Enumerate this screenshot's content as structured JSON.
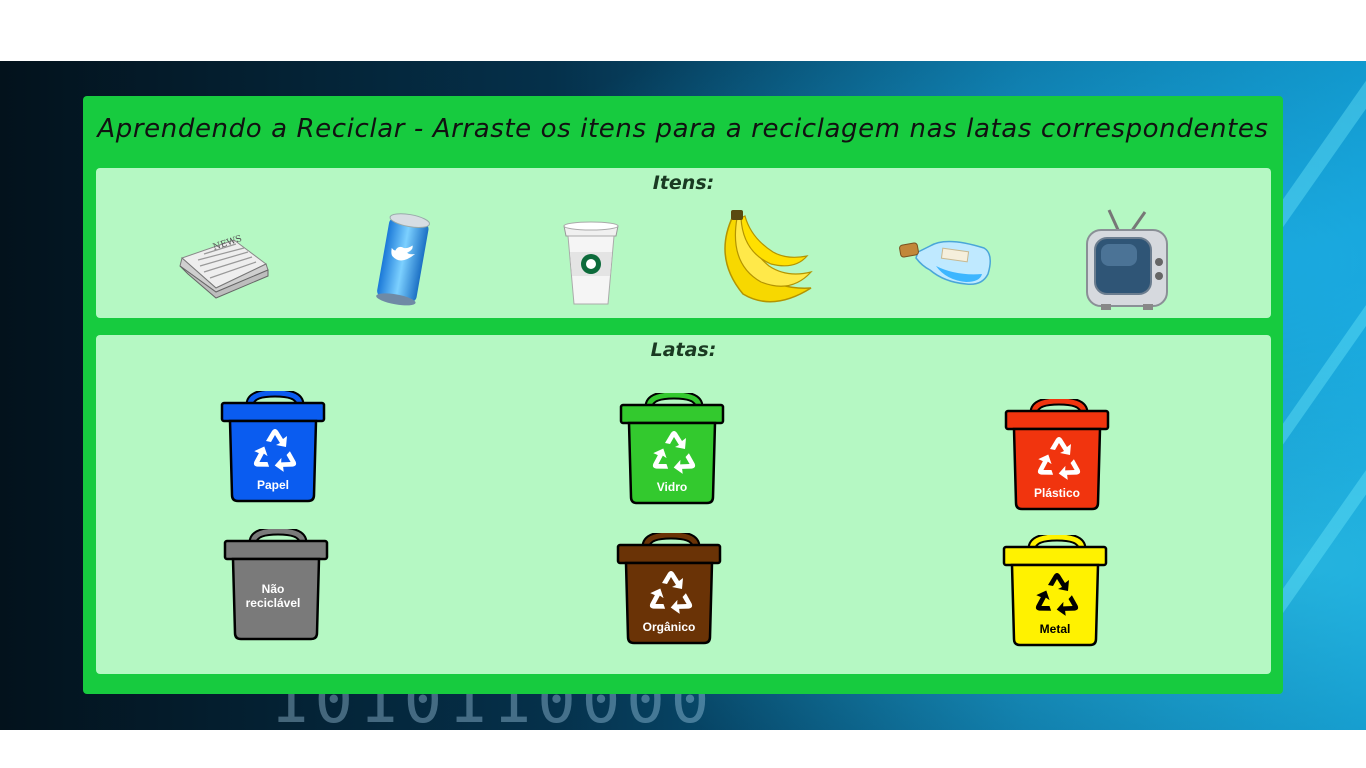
{
  "title": "Aprendendo a Reciclar - Arraste os itens para a reciclagem nas latas correspondentes",
  "items_section": {
    "label": "Itens:",
    "items": [
      "newspaper-icon",
      "soda-can-icon",
      "coffee-cup-icon",
      "banana-icon",
      "glass-bottle-icon",
      "television-icon"
    ]
  },
  "cans_section": {
    "label": "Latas:",
    "cans": [
      {
        "label_line1": "Papel",
        "label_line2": "",
        "color": "#0a5cf0",
        "symbol_color": "#ffffff"
      },
      {
        "label_line1": "Vidro",
        "label_line2": "",
        "color": "#33c92e",
        "symbol_color": "#ffffff"
      },
      {
        "label_line1": "Plástico",
        "label_line2": "",
        "color": "#f1340e",
        "symbol_color": "#ffffff"
      },
      {
        "label_line1": "Não",
        "label_line2": "reciclável",
        "color": "#7a7a7a",
        "symbol_color": "#ffffff"
      },
      {
        "label_line1": "Orgânico",
        "label_line2": "",
        "color": "#6a3306",
        "symbol_color": "#ffffff"
      },
      {
        "label_line1": "Metal",
        "label_line2": "",
        "color": "#fff200",
        "symbol_color": "#000000"
      }
    ]
  }
}
